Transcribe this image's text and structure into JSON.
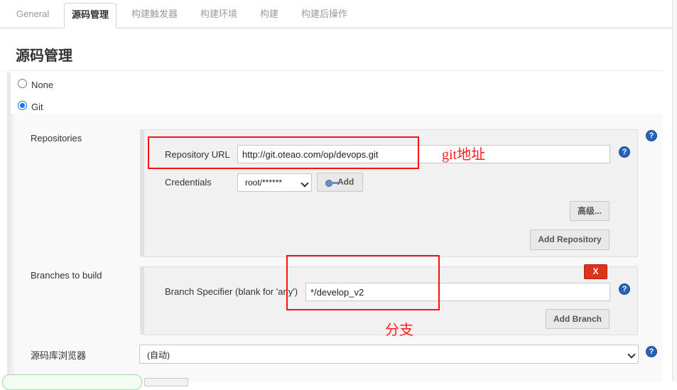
{
  "tabs": [
    {
      "label": "General"
    },
    {
      "label": "源码管理"
    },
    {
      "label": "构建触发器"
    },
    {
      "label": "构建环境"
    },
    {
      "label": "构建"
    },
    {
      "label": "构建后操作"
    }
  ],
  "section_title": "源码管理",
  "scm_options": [
    {
      "label": "None",
      "selected": false
    },
    {
      "label": "Git",
      "selected": true
    }
  ],
  "repositories": {
    "label": "Repositories",
    "url_label": "Repository URL",
    "url_value": "http://git.oteao.com/op/devops.git",
    "credentials_label": "Credentials",
    "credentials_value": "root/******",
    "add_label": "Add",
    "advanced_label": "高级...",
    "add_repository_label": "Add Repository"
  },
  "branches": {
    "label": "Branches to build",
    "delete_label": "X",
    "specifier_label": "Branch Specifier (blank for 'any')",
    "specifier_value": "*/develop_v2",
    "add_branch_label": "Add Branch"
  },
  "browser": {
    "label": "源码库浏览器",
    "value": "(自动)"
  },
  "annotations": {
    "git_url": "git地址",
    "branch": "分支"
  },
  "colors": {
    "annotation": "#ff1010",
    "help": "#2563b8",
    "delete": "#e0311a"
  }
}
